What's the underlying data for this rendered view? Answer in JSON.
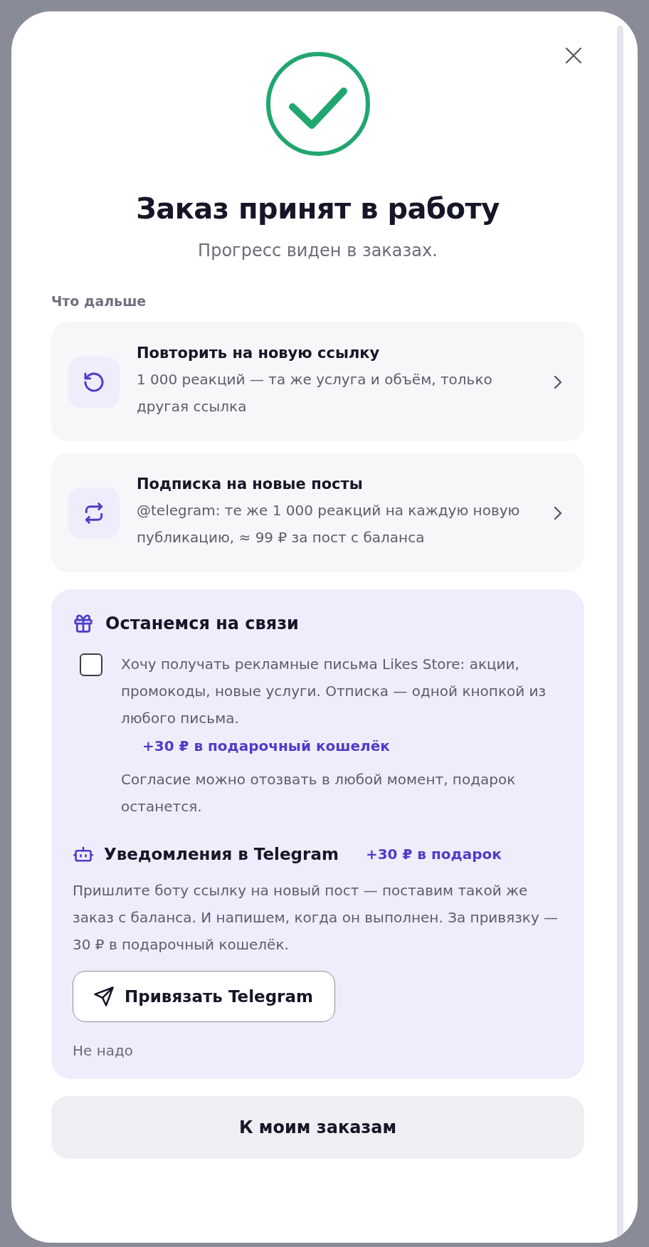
{
  "dialog": {
    "title": "Заказ принят в работу",
    "subtitle": "Прогресс виден в заказах."
  },
  "section_label": "Что дальше",
  "actions": [
    {
      "kind": "repeat",
      "title": "Повторить на новую ссылку",
      "description": "1 000 реакций — та же услуга и объём, только другая ссылка"
    },
    {
      "kind": "subscription",
      "title": "Подписка на новые посты",
      "description": "@telegram: те же 1 000 реакций на каждую новую публикацию, ≈ 99 ₽ за пост с баланса"
    }
  ],
  "stay_in_touch": {
    "title": "Останемся на связи",
    "newsletter": {
      "checked": false,
      "label": "Хочу получать рекламные письма Likes Store: акции, промокоды, новые услуги. Отписка — одной кнопкой из любого письма.",
      "bonus": "+30 ₽ в подарочный кошелёк",
      "note": "Согласие можно отозвать в любой момент, подарок останется."
    },
    "telegram": {
      "title": "Уведомления в Telegram",
      "bonus": "+30 ₽ в подарок",
      "description": "Пришлите боту ссылку на новый пост — поставим такой же заказ с баланса. И напишем, когда он выполнен. За привязку — 30 ₽ в подарочный кошелёк.",
      "button": "Привязать Telegram",
      "dismiss": "Не надо"
    }
  },
  "primary_button": "К моим заказам"
}
